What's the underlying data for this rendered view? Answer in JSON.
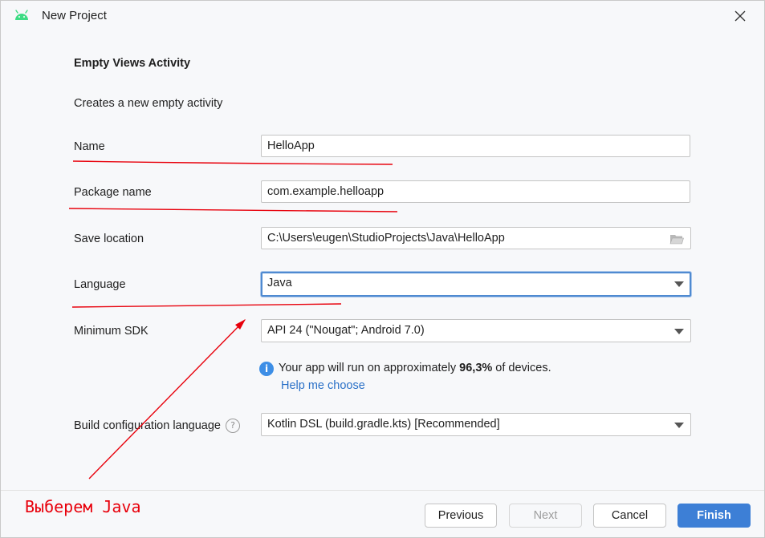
{
  "window": {
    "title": "New Project",
    "icon": "android-icon"
  },
  "form": {
    "heading": "Empty Views Activity",
    "description": "Creates a new empty activity",
    "name": {
      "label": "Name",
      "value": "HelloApp"
    },
    "package_name": {
      "label": "Package name",
      "value": "com.example.helloapp"
    },
    "save_location": {
      "label": "Save location",
      "value": "C:\\Users\\eugen\\StudioProjects\\Java\\HelloApp"
    },
    "language": {
      "label": "Language",
      "value": "Java"
    },
    "minimum_sdk": {
      "label": "Minimum SDK",
      "value": "API 24 (\"Nougat\"; Android 7.0)"
    },
    "sdk_info": {
      "prefix": "Your app will run on approximately ",
      "percent": "96,3%",
      "suffix": " of devices.",
      "help_link": "Help me choose"
    },
    "build_config": {
      "label": "Build configuration language",
      "value": "Kotlin DSL (build.gradle.kts) [Recommended]"
    }
  },
  "buttons": {
    "previous": "Previous",
    "next": "Next",
    "cancel": "Cancel",
    "finish": "Finish"
  },
  "annotation": {
    "text": "Выберем Java",
    "color": "#e8000b"
  },
  "colors": {
    "accent": "#3d7fd6",
    "link": "#2a70c7",
    "focus_ring": "#4f8ad1",
    "info": "#3d8ee6"
  }
}
